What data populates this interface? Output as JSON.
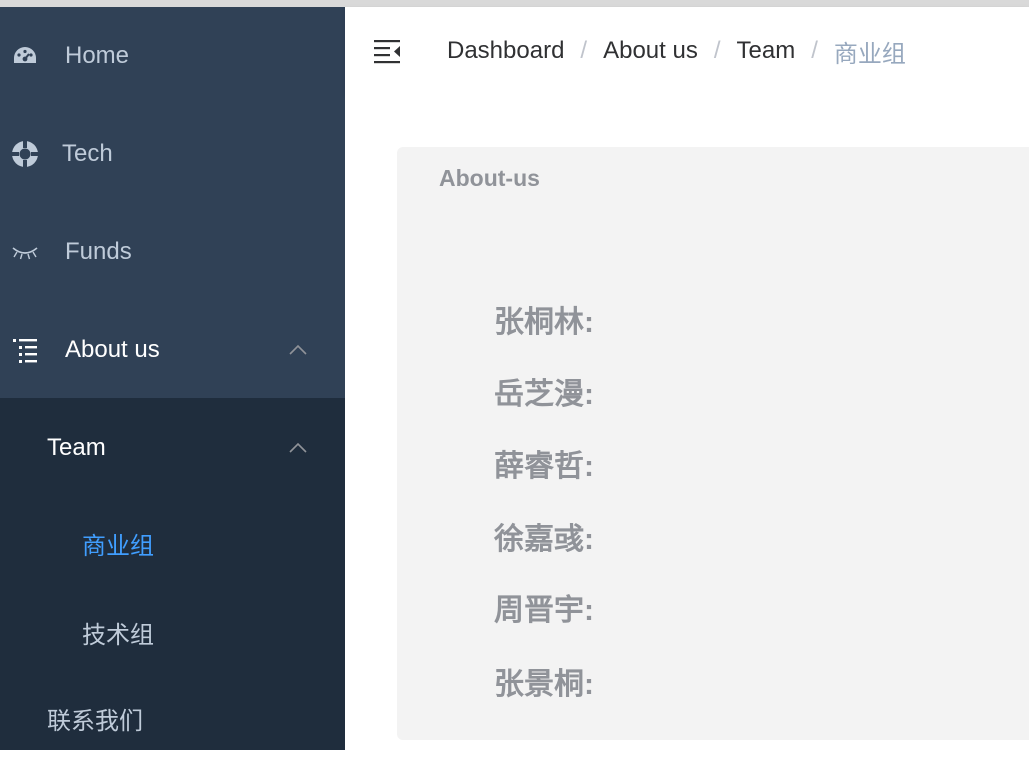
{
  "sidebar": {
    "items": [
      {
        "label": "Home",
        "icon": "dashboard-icon"
      },
      {
        "label": "Tech",
        "icon": "lifebuoy-icon"
      },
      {
        "label": "Funds",
        "icon": "eye-closed-icon"
      },
      {
        "label": "About us",
        "icon": "list-tree-icon",
        "expanded": true
      }
    ],
    "submenu": {
      "team": {
        "label": "Team",
        "expanded": true
      },
      "team_items": [
        {
          "label": "商业组",
          "active": true
        },
        {
          "label": "技术组"
        }
      ],
      "contact": {
        "label": "联系我们"
      }
    }
  },
  "navbar": {
    "hamburger_icon": "menu-fold-icon",
    "breadcrumb": [
      {
        "label": "Dashboard"
      },
      {
        "label": "About us"
      },
      {
        "label": "Team"
      },
      {
        "label": "商业组"
      }
    ],
    "separator": "/"
  },
  "main": {
    "card_title": "About-us",
    "members": [
      "张桐林:",
      "岳芝漫:",
      "薛睿哲:",
      "徐嘉彧:",
      "周晋宇:",
      "张景桐:"
    ]
  },
  "colors": {
    "sidebar_bg": "#304156",
    "submenu_bg": "#1f2d3d",
    "sidebar_text": "#bfcbd9",
    "active_text": "#409eff",
    "card_bg": "#f3f3f3",
    "muted_text": "#909399"
  }
}
